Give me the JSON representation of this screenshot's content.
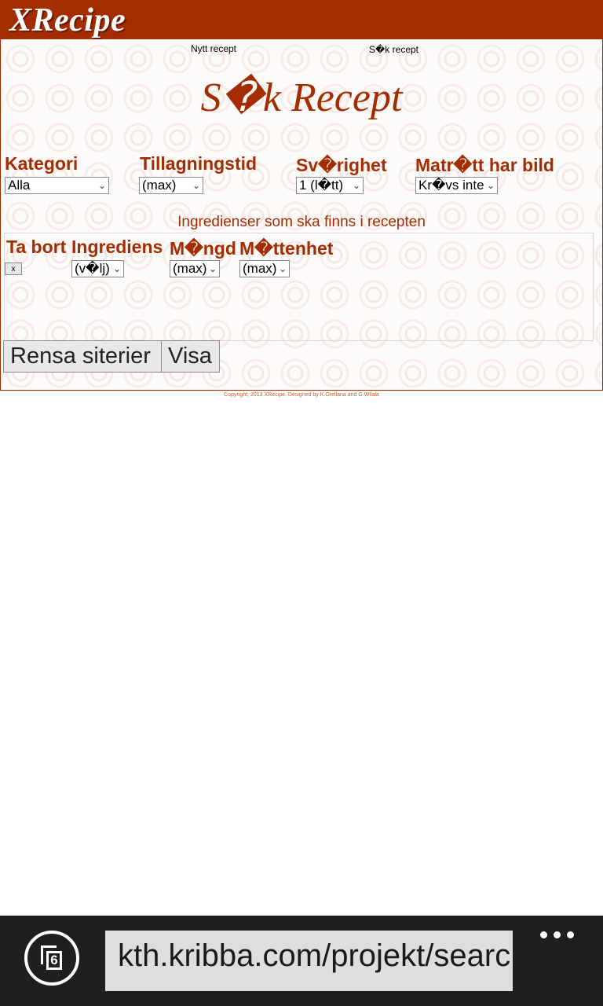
{
  "app": {
    "logo": "XRecipe"
  },
  "nav": {
    "new_recipe": "Nytt recept",
    "search_recipe": "S�k recept"
  },
  "page_title": "S�k Recept",
  "filters": {
    "category": {
      "label": "Kategori",
      "value": "Alla"
    },
    "cook_time": {
      "label": "Tillagningstid",
      "value": "(max)"
    },
    "difficulty": {
      "label": "Sv�righet",
      "value": "1 (l�tt)"
    },
    "has_image": {
      "label": "Matr�tt har bild",
      "value": "Kr�vs inte"
    }
  },
  "ingredients": {
    "caption": "Ingredienser som ska finns i recepten",
    "columns": {
      "remove": "Ta bort",
      "ingredient": "Ingrediens",
      "amount": "M�ngd",
      "unit": "M�ttenhet"
    },
    "row": {
      "remove_label": "x",
      "ingredient": "(v�lj)",
      "amount": "(max)",
      "unit": "(max)"
    }
  },
  "buttons": {
    "clear": "Rensa siterier",
    "show": "Visa"
  },
  "footer": {
    "copyright": "Copyright; 2013 XRecipe. Designed by K.Orellana and G.Wilala"
  },
  "browser": {
    "tab_count": "6",
    "url": "kth.kribba.com/projekt/search"
  },
  "colors": {
    "brand": "#a32c00",
    "browser_bar": "#1f1f1f",
    "address_bg": "#dedede"
  },
  "icons": {
    "tabs": "tabs-icon",
    "more": "more-icon"
  }
}
